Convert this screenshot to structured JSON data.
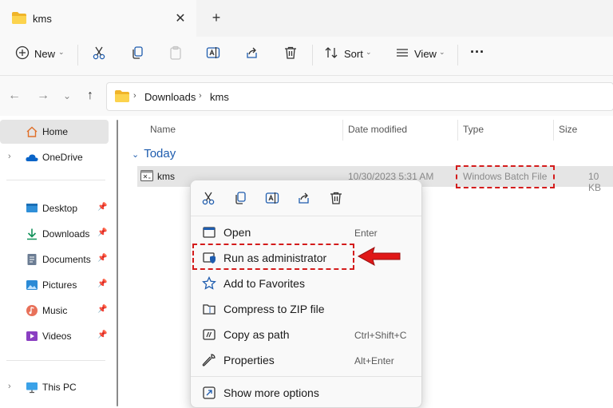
{
  "tab": {
    "title": "kms",
    "close": "✕",
    "new_tab": "+"
  },
  "toolbar": {
    "new_label": "New",
    "sort_label": "Sort",
    "view_label": "View",
    "more": "···",
    "caret": "⌄"
  },
  "nav": {
    "back": "←",
    "forward": "→",
    "recent": "⌄",
    "up": "↑"
  },
  "breadcrumb": {
    "sep1": "›",
    "item1": "Downloads",
    "sep2": "›",
    "item2": "kms"
  },
  "sidebar": {
    "expand": "›",
    "pin": "📌",
    "home": "Home",
    "onedrive": "OneDrive",
    "desktop": "Desktop",
    "downloads": "Downloads",
    "documents": "Documents",
    "pictures": "Pictures",
    "music": "Music",
    "videos": "Videos",
    "thispc": "This PC"
  },
  "columns": {
    "name": "Name",
    "date": "Date modified",
    "type": "Type",
    "size": "Size"
  },
  "group": {
    "chevron": "⌄",
    "label": "Today"
  },
  "file": {
    "name": "kms",
    "date": "10/30/2023 5:31 AM",
    "type": "Windows Batch File",
    "size": "10 KB"
  },
  "context_menu": {
    "items": [
      {
        "label": "Open",
        "shortcut": "Enter"
      },
      {
        "label": "Run as administrator",
        "shortcut": ""
      },
      {
        "label": "Add to Favorites",
        "shortcut": ""
      },
      {
        "label": "Compress to ZIP file",
        "shortcut": ""
      },
      {
        "label": "Copy as path",
        "shortcut": "Ctrl+Shift+C"
      },
      {
        "label": "Properties",
        "shortcut": "Alt+Enter"
      }
    ],
    "more": "Show more options"
  },
  "colors": {
    "accent": "#0067c0",
    "highlight": "#d41c1c",
    "folder": "#f5c02b"
  }
}
